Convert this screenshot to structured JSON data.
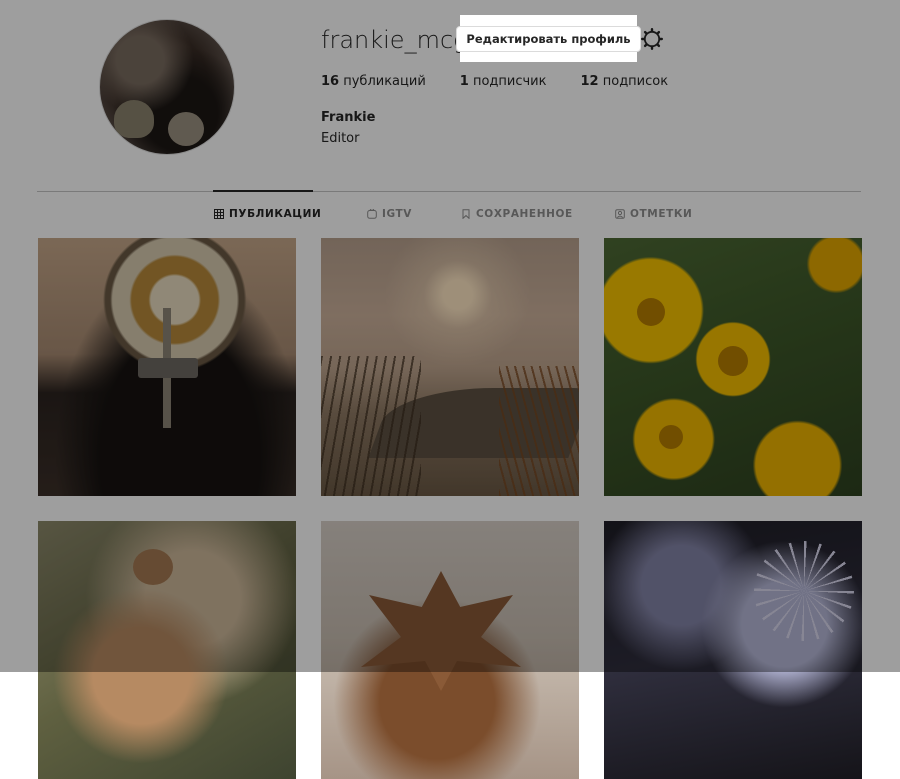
{
  "profile": {
    "username": "frankie_mcgr",
    "edit_button_label": "Редактировать профиль",
    "full_name": "Frankie",
    "bio": "Editor"
  },
  "stats": [
    {
      "count": "16",
      "label": "публикаций"
    },
    {
      "count": "1",
      "label": "подписчик"
    },
    {
      "count": "12",
      "label": "подписок"
    }
  ],
  "tabs": [
    {
      "label": "ПУБЛИКАЦИИ",
      "icon": "grid-icon",
      "active": true
    },
    {
      "label": "IGTV",
      "icon": "igtv-icon",
      "active": false
    },
    {
      "label": "СОХРАНЕННОЕ",
      "icon": "bookmark-icon",
      "active": false
    },
    {
      "label": "ОТМЕТКИ",
      "icon": "tagged-icon",
      "active": false
    }
  ],
  "icons": {
    "settings": "gear-icon"
  },
  "colors": {
    "text_primary": "#262626",
    "text_secondary": "#8e8e8e",
    "border": "#dbdbdb",
    "overlay": "rgba(0,0,0,0.38)"
  }
}
